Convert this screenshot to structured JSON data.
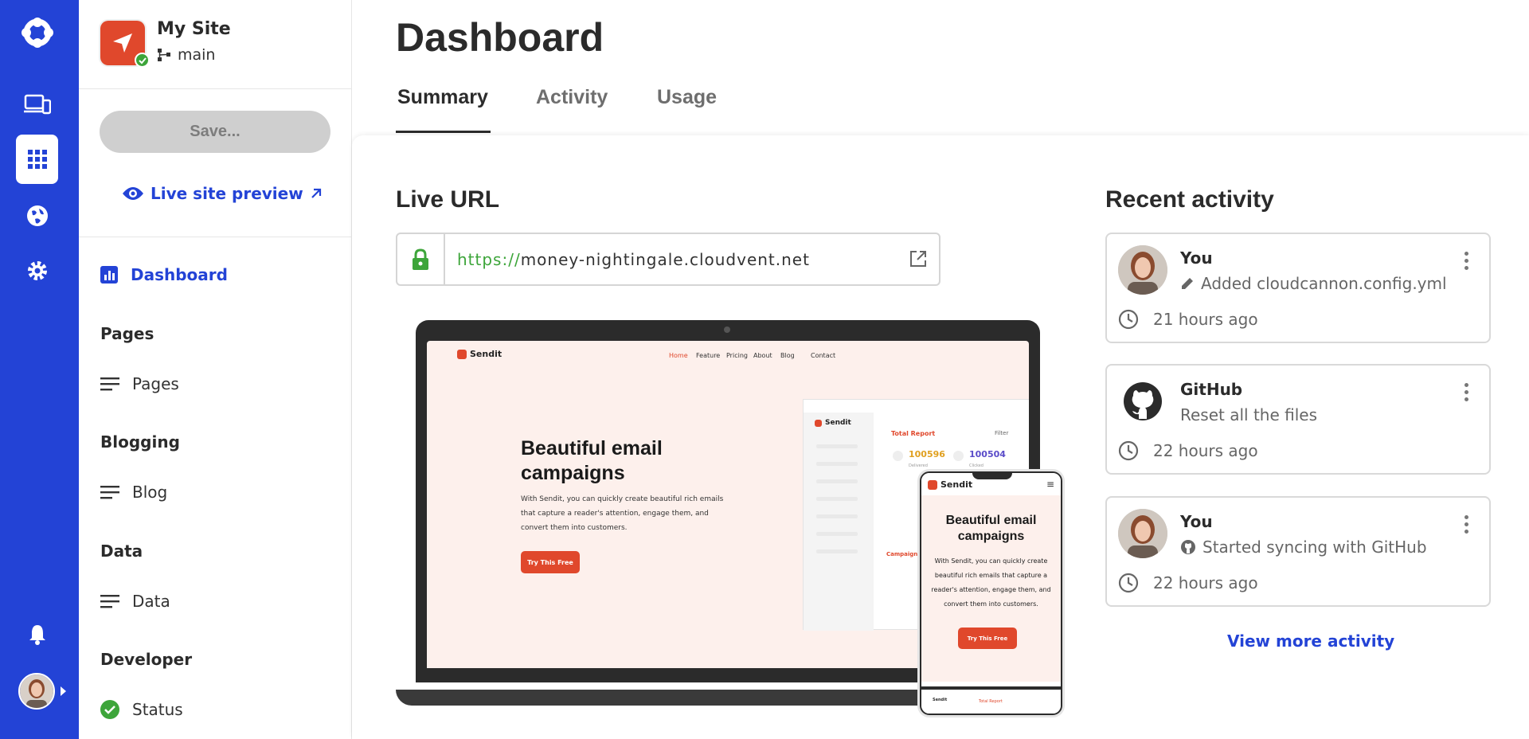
{
  "site": {
    "name": "My Site",
    "branch": "main"
  },
  "sidebar": {
    "save_label": "Save...",
    "preview_label": "Live site preview",
    "dashboard_label": "Dashboard",
    "sections": [
      {
        "title": "Pages",
        "item": "Pages"
      },
      {
        "title": "Blogging",
        "item": "Blog"
      },
      {
        "title": "Data",
        "item": "Data"
      },
      {
        "title": "Developer",
        "item": "Status"
      }
    ]
  },
  "header": {
    "title": "Dashboard",
    "tabs": [
      {
        "label": "Summary",
        "active": true
      },
      {
        "label": "Activity",
        "active": false
      },
      {
        "label": "Usage",
        "active": false
      }
    ]
  },
  "live_url": {
    "heading": "Live URL",
    "protocol": "https://",
    "host": "money-nightingale.cloudvent.net"
  },
  "preview": {
    "brand": "Sendit",
    "nav": [
      "Home",
      "Feature",
      "Pricing",
      "About",
      "Blog",
      "Contact"
    ],
    "hero_title": "Beautiful email campaigns",
    "hero_text": "With Sendit, you can quickly create beautiful rich emails that capture a reader's attention, engage them, and convert them into customers.",
    "cta": "Try This Free",
    "report_title": "Total Report",
    "report_filter": "Filter",
    "stat1": "100596",
    "stat1_label": "Delivered",
    "stat2": "100504",
    "stat2_label": "Clicked",
    "campaigns_label": "Campaigns",
    "phone_foot_brand": "Sendit",
    "phone_foot_tab": "Total Report"
  },
  "activity": {
    "heading": "Recent activity",
    "items": [
      {
        "who": "You",
        "desc": "Added cloudcannon.config.yml",
        "time": "21 hours ago",
        "avatar": "user-avatar",
        "desc_icon": "pencil-icon"
      },
      {
        "who": "GitHub",
        "desc": "Reset all the files",
        "time": "22 hours ago",
        "avatar": "github-icon",
        "desc_icon": ""
      },
      {
        "who": "You",
        "desc": "Started syncing with GitHub",
        "time": "22 hours ago",
        "avatar": "user-avatar",
        "desc_icon": "github-icon"
      }
    ],
    "more_label": "View more activity"
  },
  "colors": {
    "brand": "#2343d6",
    "success": "#3da53a",
    "accent": "#e0482c"
  }
}
